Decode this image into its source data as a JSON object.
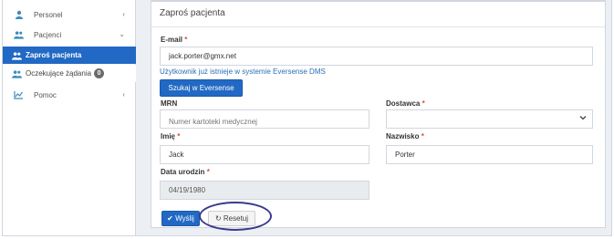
{
  "sidebar": {
    "items": [
      {
        "label": "Personel",
        "icon": "user-icon"
      },
      {
        "label": "Pacjenci",
        "icon": "users-icon"
      },
      {
        "label": "Pomoc",
        "icon": "chart-line-icon"
      }
    ],
    "subitems": [
      {
        "label": "Zaproś pacjenta",
        "icon": "users-icon",
        "active": true
      },
      {
        "label": "Oczekujące żądania",
        "badge": "0",
        "icon": "users-icon"
      }
    ],
    "chevrons": {
      "collapsed": "‹",
      "expanded": "⌄"
    }
  },
  "panel": {
    "title": "Zaproś pacjenta",
    "email": {
      "label": "E-mail",
      "required": "*",
      "value": "jack.porter@gmx.net",
      "note": "Użytkownik już istnieje w systemie Eversense DMS",
      "search_button": "Szukaj w Eversense"
    },
    "mrn": {
      "label": "MRN",
      "placeholder": "Numer kartoteki medycznej"
    },
    "provider": {
      "label": "Dostawca",
      "required": "*",
      "value": ""
    },
    "first_name": {
      "label": "Imię",
      "required": "*",
      "value": "Jack"
    },
    "last_name": {
      "label": "Nazwisko",
      "required": "*",
      "value": "Porter"
    },
    "dob": {
      "label": "Data urodzin",
      "required": "*",
      "value": "04/19/1980"
    },
    "submit_button": "Wyślij",
    "reset_button": "Resetuj"
  },
  "colors": {
    "accent": "#2169c4",
    "required": "#dd4b39",
    "highlight_oval": "#3b3a8c"
  }
}
